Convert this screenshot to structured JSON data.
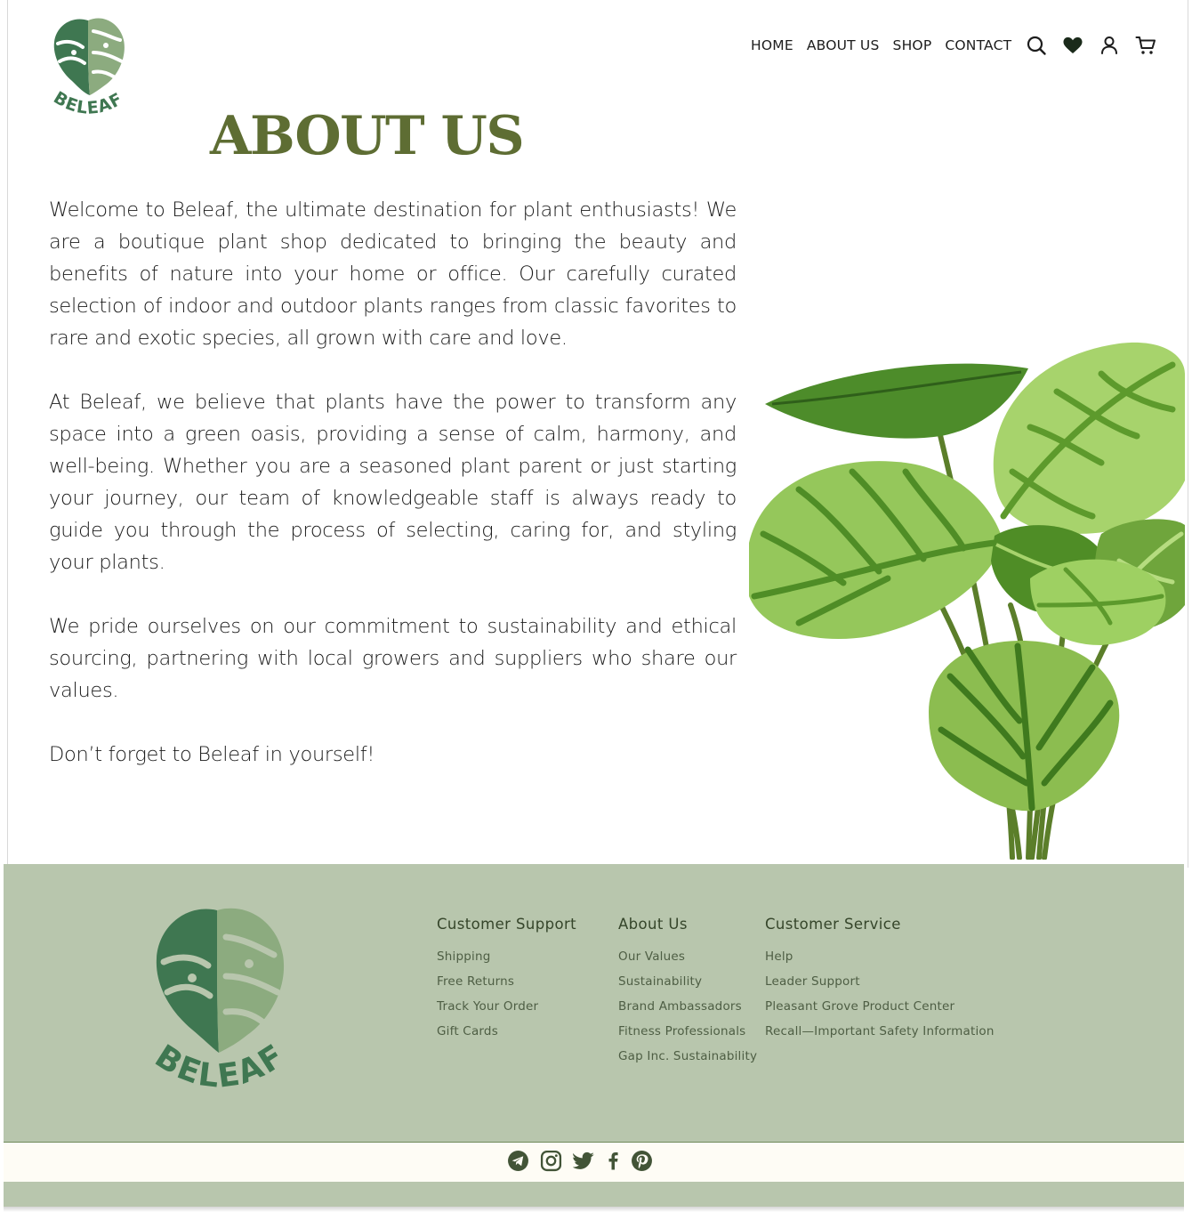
{
  "brand": {
    "name": "BELEAF",
    "colors": {
      "leaf_dark": "#3f7751",
      "leaf_light": "#8cab7f",
      "title": "#5e6d33",
      "footer_bg": "#b8c6ad",
      "social_bar_bg": "#fefcf5"
    }
  },
  "nav": {
    "items": [
      "HOME",
      "ABOUT US",
      "SHOP",
      "CONTACT"
    ],
    "icons": [
      "search-icon",
      "heart-icon",
      "user-icon",
      "cart-icon"
    ]
  },
  "page": {
    "title": "ABOUT US",
    "paragraphs": [
      "Welcome to Beleaf, the ultimate destination for plant enthusiasts! We are a boutique plant shop dedicated to bringing the beauty and benefits of nature into your home or office. Our carefully curated selection of indoor and outdoor plants ranges from classic favorites to rare and exotic species, all grown with care and love.",
      "At Beleaf, we believe that plants have the power to transform any space into a green oasis, providing a sense of calm, harmony, and well-being. Whether you are a seasoned plant parent or just starting your journey, our team of knowledgeable staff is always ready to guide you through the process of selecting, caring for, and styling your plants.",
      "We pride ourselves on our commitment to sustainability and ethical sourcing, partnering with local growers and suppliers who share our values.",
      "Don’t forget to Beleaf in yourself!"
    ]
  },
  "footer": {
    "columns": [
      {
        "heading": "Customer Support",
        "links": [
          "Shipping",
          "Free Returns",
          "Track Your Order",
          "Gift Cards"
        ]
      },
      {
        "heading": "About Us",
        "links": [
          "Our Values",
          "Sustainability",
          "Brand Ambassadors",
          "Fitness Professionals",
          "Gap Inc. Sustainability"
        ]
      },
      {
        "heading": "Customer Service",
        "links": [
          "Help",
          "Leader Support",
          "Pleasant Grove Product Center",
          "Recall—Important Safety Information"
        ]
      }
    ],
    "social": [
      "telegram-icon",
      "instagram-icon",
      "twitter-icon",
      "facebook-icon",
      "pinterest-icon"
    ]
  }
}
